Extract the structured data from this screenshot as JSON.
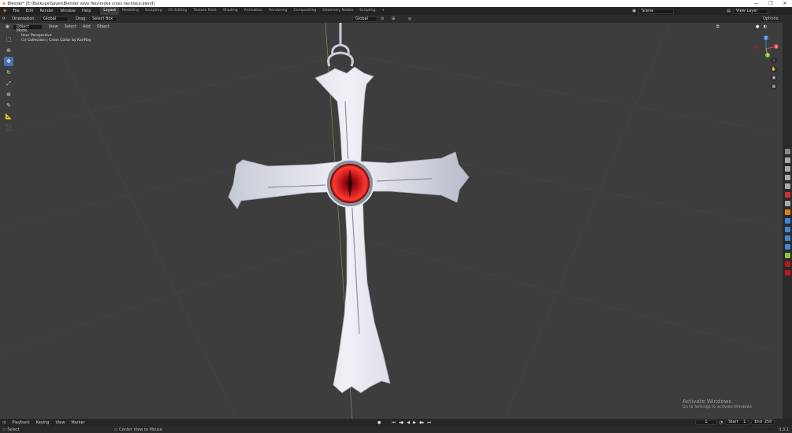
{
  "window": {
    "title": "Blender* [E:\\Backups\\Saves\\Blender save files\\moka cross necklace.blend]",
    "minimize": "—",
    "maximize": "❐",
    "close": "✕"
  },
  "menu": [
    "File",
    "Edit",
    "Render",
    "Window",
    "Help"
  ],
  "workspaces": [
    "Layout",
    "Modeling",
    "Sculpting",
    "UV Editing",
    "Texture Paint",
    "Shading",
    "Animation",
    "Rendering",
    "Compositing",
    "Geometry Nodes",
    "Scripting"
  ],
  "workspace_add": "+",
  "scene": {
    "label": "Scene",
    "view_layer": "View Layer"
  },
  "tool_header": {
    "orientation_label": "Orientation:",
    "orientation_value": "Global",
    "drag_label": "Drag:",
    "drag_value": "Select Box",
    "transform_value": "Global",
    "options": "Options"
  },
  "viewport_header": {
    "mode": "Object Mode",
    "menus": [
      "View",
      "Select",
      "Add",
      "Object"
    ]
  },
  "viewport_overlay": {
    "line1": "User Perspective",
    "line2": "(1) Collection | Cross Collar by KarlRay"
  },
  "gizmo": {
    "x": "X",
    "y": "Y",
    "z": "Z"
  },
  "watermark": {
    "line1": "Activate Windows",
    "line2": "Go to Settings to activate Windows."
  },
  "timeline": {
    "menus": [
      "Playback",
      "Keying",
      "View",
      "Marker"
    ],
    "current_frame": "1",
    "start_label": "Start",
    "start_value": "1",
    "end_label": "End",
    "end_value": "250"
  },
  "status": {
    "left": "Select",
    "middle": "Center View to Mouse",
    "version": "3.3.1"
  },
  "colors": {
    "accent": "#4772b3",
    "viewport_bg": "#3d3d3d",
    "gem": "#c0151b",
    "axis_x": "#e0454f",
    "axis_y": "#8fc43c",
    "axis_z": "#3b87d9"
  }
}
